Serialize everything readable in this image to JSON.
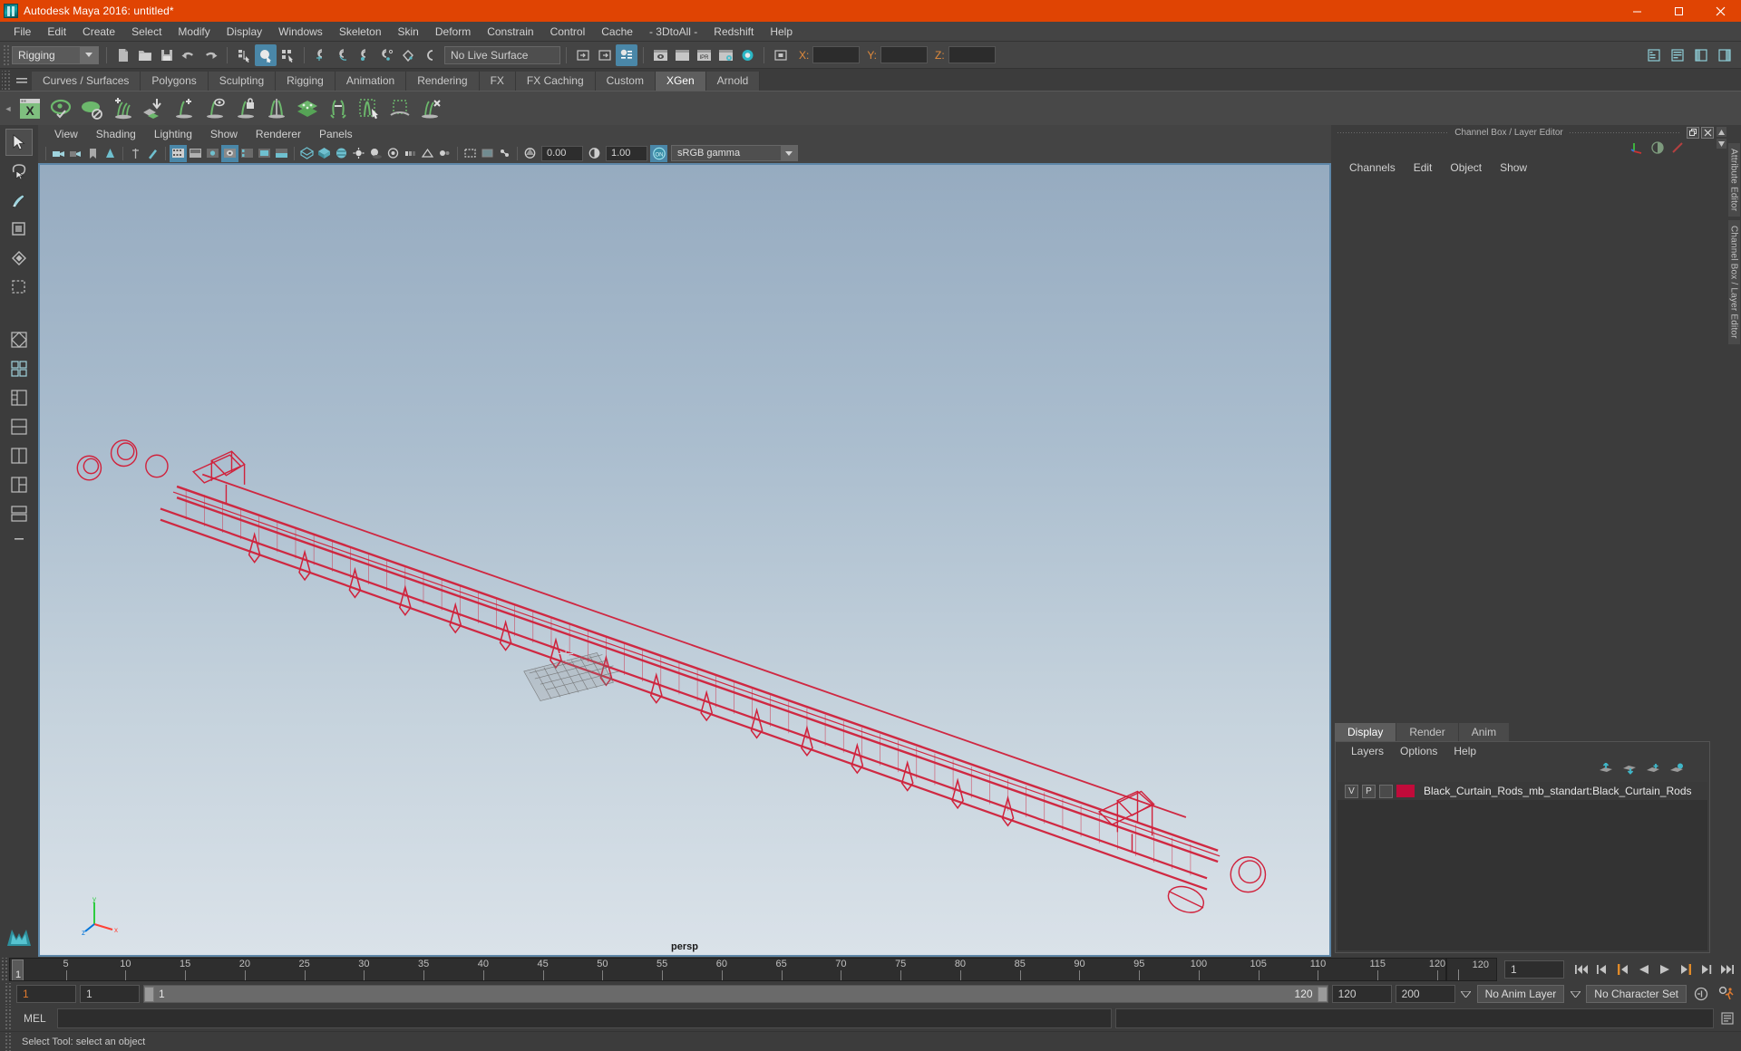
{
  "window": {
    "title": "Autodesk Maya 2016: untitled*",
    "icon": "maya-app-icon",
    "minimize": "minimize-icon",
    "maximize": "maximize-icon",
    "close": "close-icon",
    "titlebar_color": "#e04403"
  },
  "menubar": {
    "items": [
      {
        "label": "File"
      },
      {
        "label": "Edit"
      },
      {
        "label": "Create"
      },
      {
        "label": "Select"
      },
      {
        "label": "Modify"
      },
      {
        "label": "Display"
      },
      {
        "label": "Windows"
      },
      {
        "label": "Skeleton"
      },
      {
        "label": "Skin"
      },
      {
        "label": "Deform"
      },
      {
        "label": "Constrain"
      },
      {
        "label": "Control"
      },
      {
        "label": "Cache"
      },
      {
        "label": "- 3DtoAll -"
      },
      {
        "label": "Redshift"
      },
      {
        "label": "Help"
      }
    ]
  },
  "toolbar": {
    "menuset": "Rigging",
    "live_surface": "No Live Surface",
    "coord_x_label": "X:",
    "coord_y_label": "Y:",
    "coord_z_label": "Z:",
    "coord_x_value": "",
    "coord_y_value": "",
    "coord_z_value": "",
    "icons": [
      "new-scene-icon",
      "open-scene-icon",
      "save-scene-icon",
      "undo-icon",
      "redo-icon",
      "select-by-hierarchy-icon",
      "select-by-object-icon",
      "select-by-component-icon",
      "snap-to-grid-icon",
      "snap-to-curve-icon",
      "snap-to-point-icon",
      "snap-to-projected-center-icon",
      "snap-to-view-plane-icon",
      "make-live-icon",
      "show-hide-editor-icon",
      "sidebar-toggle-icon",
      "attribute-editor-icon",
      "render-current-frame-icon",
      "render-sequence-icon",
      "ipr-render-icon",
      "render-settings-icon",
      "hypershade-icon",
      "toggle-panel-icon"
    ]
  },
  "shelf": {
    "tabs": [
      {
        "label": "Curves / Surfaces",
        "selected": false
      },
      {
        "label": "Polygons",
        "selected": false
      },
      {
        "label": "Sculpting",
        "selected": false
      },
      {
        "label": "Rigging",
        "selected": false
      },
      {
        "label": "Animation",
        "selected": false
      },
      {
        "label": "Rendering",
        "selected": false
      },
      {
        "label": "FX",
        "selected": false
      },
      {
        "label": "FX Caching",
        "selected": false
      },
      {
        "label": "Custom",
        "selected": false
      },
      {
        "label": "XGen",
        "selected": true
      },
      {
        "label": "Arnold",
        "selected": false
      }
    ],
    "icons": [
      "xgen-window-icon",
      "xgen-preview-icon",
      "xgen-hide-preview-icon",
      "xgen-add-description-icon",
      "xgen-import-collection-icon",
      "xgen-add-guide-icon",
      "xgen-show-guide-icon",
      "xgen-lock-guide-icon",
      "xgen-mirror-guide-icon",
      "xgen-sculpt-icon",
      "xgen-groom-icon",
      "xgen-select-guides-icon",
      "xgen-region-icon",
      "xgen-delete-guide-icon"
    ]
  },
  "toolbox": {
    "tools": [
      {
        "name": "select-tool",
        "selected": true
      },
      {
        "name": "lasso-select-tool",
        "selected": false
      },
      {
        "name": "paint-select-tool",
        "selected": false
      },
      {
        "name": "move-tool",
        "selected": false
      },
      {
        "name": "rotate-tool",
        "selected": false
      },
      {
        "name": "scale-tool",
        "selected": false
      },
      {
        "name": "last-tool-used",
        "selected": false
      },
      {
        "name": "single-perspective-layout",
        "selected": false
      },
      {
        "name": "four-view-layout",
        "selected": false
      },
      {
        "name": "persp-outliner-layout",
        "selected": false
      },
      {
        "name": "persp-graph-layout",
        "selected": false
      },
      {
        "name": "two-pane-layout",
        "selected": false
      },
      {
        "name": "three-pane-layout",
        "selected": false
      },
      {
        "name": "hypershade-layout",
        "selected": false
      },
      {
        "name": "more-layouts",
        "selected": false
      }
    ],
    "logo": "maya-logo-icon"
  },
  "viewport": {
    "menus": [
      {
        "label": "View"
      },
      {
        "label": "Shading"
      },
      {
        "label": "Lighting"
      },
      {
        "label": "Show"
      },
      {
        "label": "Renderer"
      },
      {
        "label": "Panels"
      }
    ],
    "exposure_value": "0.00",
    "gamma_value": "1.00",
    "color_space": "sRGB gamma",
    "camera_label": "persp",
    "axis_x": "x",
    "axis_y": "y",
    "axis_z": "z",
    "toolbar_icons": [
      "select-camera-icon",
      "camera-attributes-icon",
      "bookmarks-icon",
      "image-plane-icon",
      "2d-pan-zoom-icon",
      "grease-pencil-icon",
      "film-gate-icon",
      "resolution-gate-icon",
      "gate-mask-icon",
      "field-chart-icon",
      "safe-action-icon",
      "safe-title-icon",
      "wireframe-icon",
      "smooth-shade-all-icon",
      "shade-textured-icon",
      "use-default-lighting-icon",
      "shadows-icon",
      "screen-space-ao-icon",
      "motion-blur-icon",
      "multisample-aa-icon",
      "depth-of-field-icon",
      "isolate-select-icon",
      "xray-icon",
      "xray-joints-icon",
      "exposure-icon",
      "gamma-icon",
      "color-management-icon"
    ],
    "scene_object_color": "#d0223c",
    "bg_top": "#9cb0c4",
    "bg_bottom": "#d5dfe7"
  },
  "right_panel": {
    "title": "Channel Box / Layer Editor",
    "restore_icon": "restore-panel-icon",
    "close_icon": "close-panel-icon",
    "top_icons": [
      "channel-box-icon",
      "attribute-editor-icon",
      "modeling-toolkit-icon"
    ],
    "channel_menus": [
      {
        "label": "Channels"
      },
      {
        "label": "Edit"
      },
      {
        "label": "Object"
      },
      {
        "label": "Show"
      }
    ],
    "side_tabs": [
      {
        "label": "Attribute Editor"
      },
      {
        "label": "Channel Box / Layer Editor"
      }
    ],
    "layer_editor": {
      "tabs": [
        {
          "label": "Display",
          "selected": true
        },
        {
          "label": "Render",
          "selected": false
        },
        {
          "label": "Anim",
          "selected": false
        }
      ],
      "menus": [
        {
          "label": "Layers"
        },
        {
          "label": "Options"
        },
        {
          "label": "Help"
        }
      ],
      "tool_icons": [
        "move-layer-up-icon",
        "move-layer-down-icon",
        "new-layer-icon",
        "new-layer-from-selected-icon"
      ],
      "layers": [
        {
          "visibility": "V",
          "playback": "P",
          "shading": "",
          "color": "#c10b3a",
          "name": "Black_Curtain_Rods_mb_standart:Black_Curtain_Rods"
        }
      ]
    }
  },
  "time_slider": {
    "start": 1,
    "end": 120,
    "current_frame": "1",
    "tick_labels": [
      "5",
      "10",
      "15",
      "20",
      "25",
      "30",
      "35",
      "40",
      "45",
      "50",
      "55",
      "60",
      "65",
      "70",
      "75",
      "80",
      "85",
      "90",
      "95",
      "100",
      "105",
      "110",
      "115",
      "120"
    ],
    "end_label": "120",
    "cursor_label": "1",
    "playback_buttons": [
      "go-to-start-icon",
      "step-back-keyframe-icon",
      "step-back-frame-icon",
      "play-backwards-icon",
      "play-forwards-icon",
      "step-forward-frame-icon",
      "step-forward-keyframe-icon",
      "go-to-end-icon"
    ]
  },
  "range_slider": {
    "anim_start": "1",
    "range_start": "1",
    "bar_start_label": "1",
    "bar_end_label": "120",
    "range_end": "120",
    "anim_end": "200",
    "anim_layer": "No Anim Layer",
    "character_set": "No Character Set",
    "auto_key_icon": "auto-keyframe-icon",
    "anim_prefs_icon": "animation-preferences-icon"
  },
  "command_line": {
    "language": "MEL",
    "input_value": "",
    "output_value": "",
    "script_editor_icon": "script-editor-icon"
  },
  "status_bar": {
    "message": "Select Tool: select an object"
  }
}
